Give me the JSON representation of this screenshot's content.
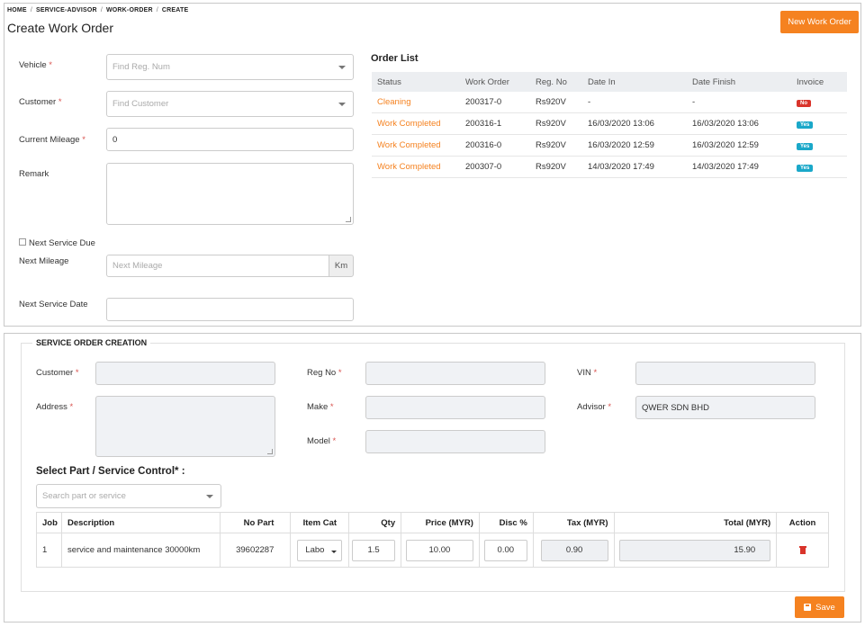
{
  "breadcrumb": [
    "HOME",
    "SERVICE-ADVISOR",
    "WORK-ORDER",
    "CREATE"
  ],
  "page_title": "Create Work Order",
  "new_work_order_label": "New Work Order",
  "form": {
    "vehicle_label": "Vehicle",
    "vehicle_placeholder": "Find Reg. Num",
    "customer_label": "Customer",
    "customer_placeholder": "Find Customer",
    "mileage_label": "Current Mileage",
    "mileage_value": "0",
    "remark_label": "Remark",
    "next_service_due_label": "Next Service Due",
    "next_mileage_label": "Next Mileage",
    "next_mileage_placeholder": "Next Mileage",
    "next_mileage_unit": "Km",
    "next_service_date_label": "Next Service Date",
    "required_mark": "*"
  },
  "order_list": {
    "title": "Order List",
    "columns": [
      "Status",
      "Work Order",
      "Reg. No",
      "Date In",
      "Date Finish",
      "Invoice"
    ],
    "rows": [
      {
        "status": "Cleaning",
        "work_order": "200317-0",
        "reg_no": "Rs920V",
        "date_in": "-",
        "date_finish": "-",
        "invoice": "No"
      },
      {
        "status": "Work Completed",
        "work_order": "200316-1",
        "reg_no": "Rs920V",
        "date_in": "16/03/2020 13:06",
        "date_finish": "16/03/2020 13:06",
        "invoice": "Yes"
      },
      {
        "status": "Work Completed",
        "work_order": "200316-0",
        "reg_no": "Rs920V",
        "date_in": "16/03/2020 12:59",
        "date_finish": "16/03/2020 12:59",
        "invoice": "Yes"
      },
      {
        "status": "Work Completed",
        "work_order": "200307-0",
        "reg_no": "Rs920V",
        "date_in": "14/03/2020 17:49",
        "date_finish": "14/03/2020 17:49",
        "invoice": "Yes"
      }
    ]
  },
  "service_order": {
    "legend": "SERVICE ORDER CREATION",
    "customer_label": "Customer",
    "address_label": "Address",
    "reg_no_label": "Reg No",
    "make_label": "Make",
    "model_label": "Model",
    "vin_label": "VIN",
    "advisor_label": "Advisor",
    "advisor_value": "QWER SDN BHD",
    "select_part_title": "Select Part / Service Control* :",
    "search_placeholder": "Search part or service",
    "table_columns": [
      "Job",
      "Description",
      "No Part",
      "Item Cat",
      "Qty",
      "Price (MYR)",
      "Disc %",
      "Tax (MYR)",
      "Total (MYR)",
      "Action"
    ],
    "items": [
      {
        "job": "1",
        "description": "service and maintenance 30000km",
        "no_part": "39602287",
        "item_cat": "Labo",
        "qty": "1.5",
        "price": "10.00",
        "disc": "0.00",
        "tax": "0.90",
        "total": "15.90"
      }
    ],
    "save_label": "Save"
  },
  "colors": {
    "accent_orange": "#f58220",
    "badge_no": "#d9342b",
    "badge_yes": "#1aa8c9",
    "required": "#d9534f"
  }
}
